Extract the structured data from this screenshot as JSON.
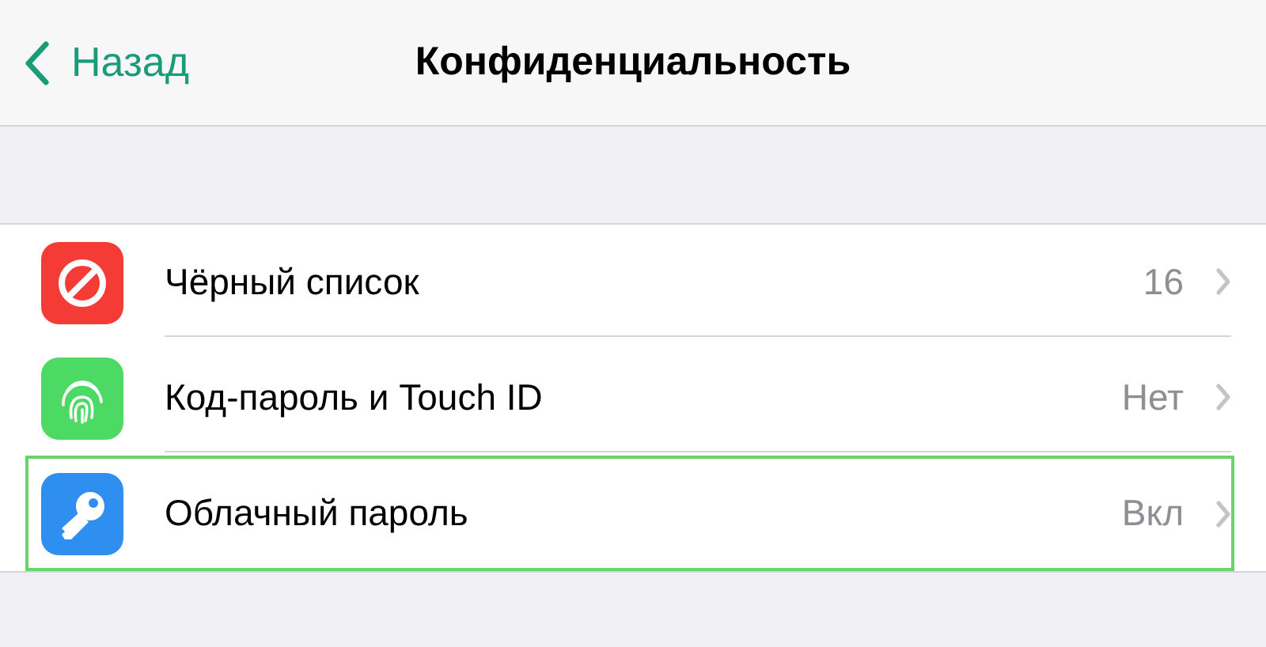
{
  "nav": {
    "back": "Назад",
    "title": "Конфиденциальность"
  },
  "rows": [
    {
      "kind": "blocked",
      "label": "Чёрный список",
      "value": "16",
      "selected": false
    },
    {
      "kind": "fingerprint",
      "label": "Код-пароль и Touch ID",
      "value": "Нет",
      "selected": false
    },
    {
      "kind": "key",
      "label": "Облачный пароль",
      "value": "Вкл",
      "selected": true
    }
  ]
}
